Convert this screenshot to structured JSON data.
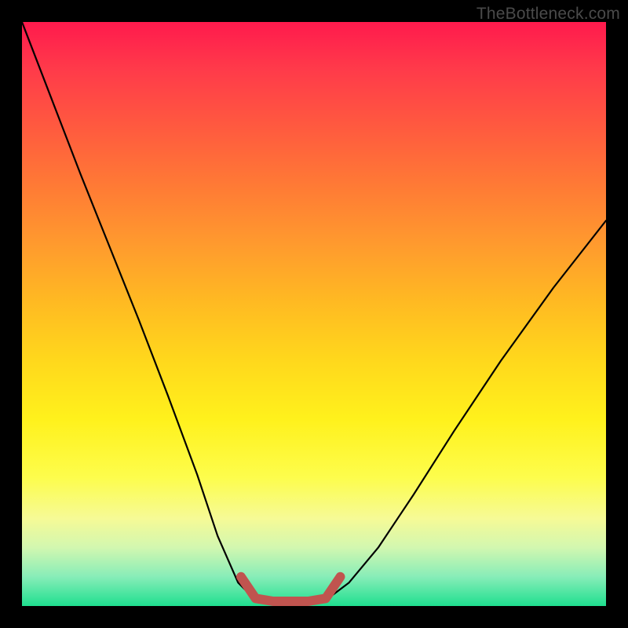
{
  "watermark": "TheBottleneck.com",
  "colors": {
    "curve": "#000000",
    "accent": "#c0544f",
    "gradient_top": "#ff1a4d",
    "gradient_bottom": "#1fdf8f"
  },
  "chart_data": {
    "type": "line",
    "title": "",
    "xlabel": "",
    "ylabel": "",
    "xlim": [
      0,
      1
    ],
    "ylim": [
      0,
      1
    ],
    "series": [
      {
        "name": "left-curve",
        "x": [
          0.0,
          0.05,
          0.1,
          0.15,
          0.2,
          0.25,
          0.3,
          0.335,
          0.37,
          0.4
        ],
        "values": [
          1.0,
          0.87,
          0.74,
          0.615,
          0.49,
          0.36,
          0.225,
          0.12,
          0.04,
          0.01
        ]
      },
      {
        "name": "floor",
        "x": [
          0.4,
          0.43,
          0.46,
          0.49,
          0.52
        ],
        "values": [
          0.01,
          0.005,
          0.005,
          0.005,
          0.01
        ]
      },
      {
        "name": "right-curve",
        "x": [
          0.52,
          0.56,
          0.61,
          0.67,
          0.74,
          0.82,
          0.91,
          1.0
        ],
        "values": [
          0.01,
          0.04,
          0.1,
          0.19,
          0.3,
          0.42,
          0.545,
          0.66
        ]
      },
      {
        "name": "accent-segment",
        "x": [
          0.375,
          0.4,
          0.43,
          0.46,
          0.49,
          0.52,
          0.545
        ],
        "values": [
          0.05,
          0.013,
          0.008,
          0.008,
          0.008,
          0.013,
          0.05
        ]
      }
    ]
  }
}
